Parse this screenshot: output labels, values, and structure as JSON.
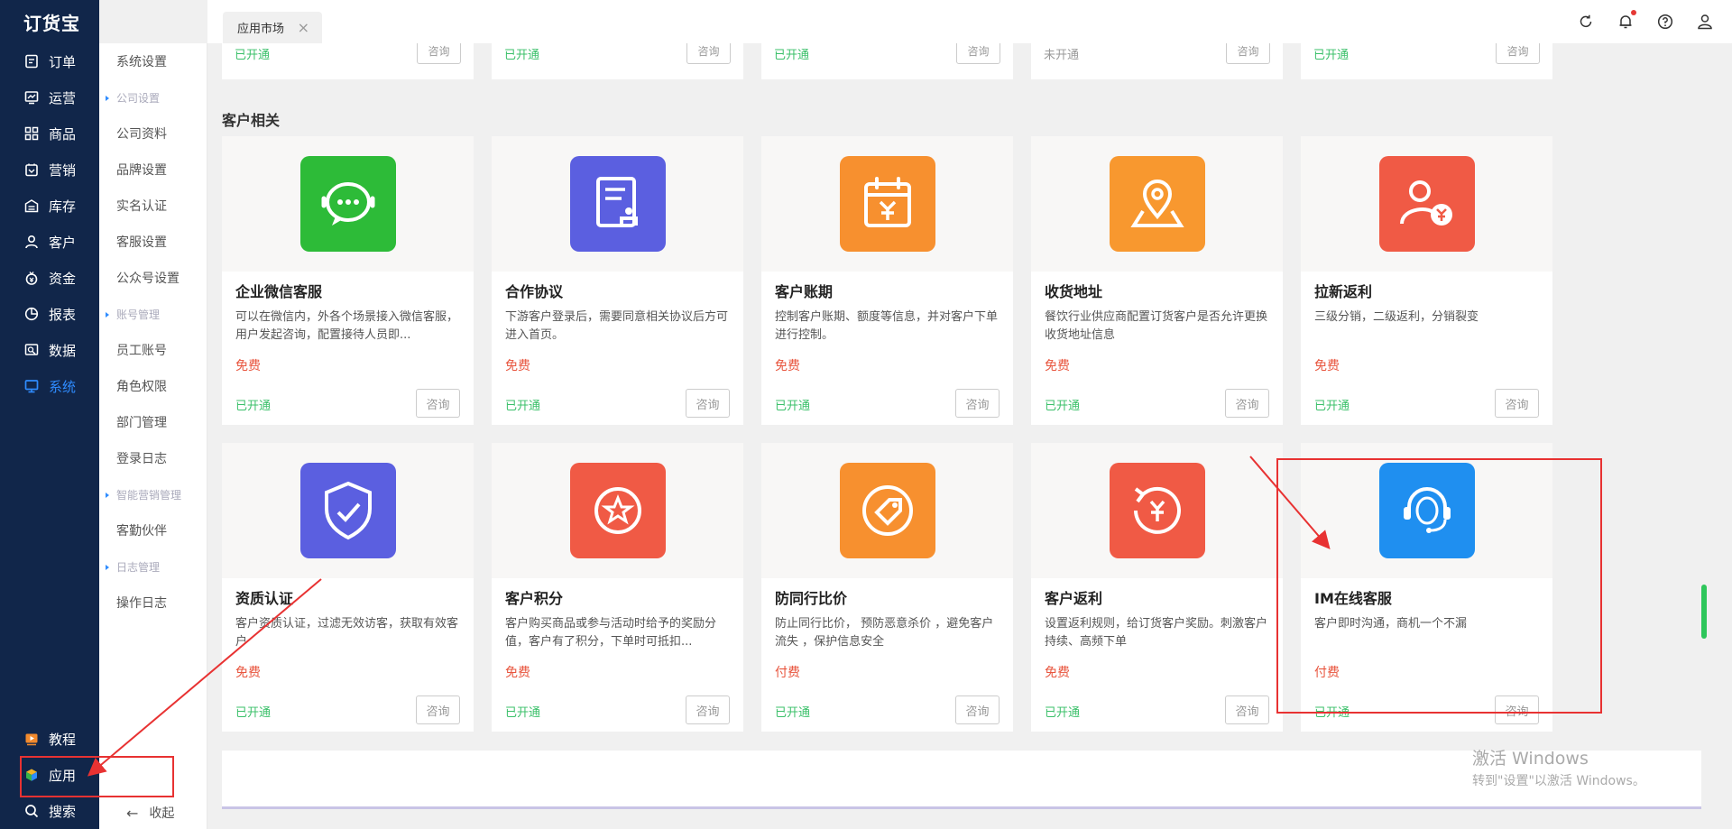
{
  "nav": {
    "logo": "订货宝",
    "items": [
      {
        "label": "订单",
        "icon": "order-icon"
      },
      {
        "label": "运营",
        "icon": "operation-icon"
      },
      {
        "label": "商品",
        "icon": "goods-icon"
      },
      {
        "label": "营销",
        "icon": "marketing-icon"
      },
      {
        "label": "库存",
        "icon": "warehouse-icon"
      },
      {
        "label": "客户",
        "icon": "customer-icon"
      },
      {
        "label": "资金",
        "icon": "money-icon"
      },
      {
        "label": "报表",
        "icon": "report-icon"
      },
      {
        "label": "数据",
        "icon": "data-icon"
      },
      {
        "label": "系统",
        "icon": "system-icon"
      }
    ],
    "bottom": [
      {
        "label": "教程",
        "icon": "tutorial-icon"
      },
      {
        "label": "应用",
        "icon": "app-icon"
      },
      {
        "label": "搜索",
        "icon": "search-icon"
      }
    ]
  },
  "submenu": {
    "items": [
      "系统设置",
      "公司设置",
      "公司资料",
      "品牌设置",
      "实名认证",
      "客服设置",
      "公众号设置",
      "账号管理",
      "员工账号",
      "角色权限",
      "部门管理",
      "登录日志",
      "智能营销管理",
      "客勤伙伴",
      "日志管理",
      "操作日志"
    ],
    "collapse": "收起"
  },
  "tab": {
    "label": "应用市场",
    "close": "×"
  },
  "top_partial": [
    {
      "status": "已开通",
      "button": "咨询"
    },
    {
      "status": "已开通",
      "button": "咨询"
    },
    {
      "status": "已开通",
      "button": "咨询"
    },
    {
      "status": "未开通",
      "button": "咨询"
    },
    {
      "status": "已开通",
      "button": "咨询"
    }
  ],
  "section": {
    "title": "客户相关"
  },
  "row1": [
    {
      "name": "企业微信客服",
      "desc": "可以在微信内，外各个场景接入微信客服，用户发起咨询，配置接待人员即...",
      "price": "免费",
      "status": "已开通",
      "button": "咨询",
      "color": "#2dbb38"
    },
    {
      "name": "合作协议",
      "desc": "下游客户登录后，需要同意相关协议后方可进入首页。",
      "price": "免费",
      "status": "已开通",
      "button": "咨询",
      "color": "#5b5fe0"
    },
    {
      "name": "客户账期",
      "desc": "控制客户账期、额度等信息，并对客户下单进行控制。",
      "price": "免费",
      "status": "已开通",
      "button": "咨询",
      "color": "#f7902f"
    },
    {
      "name": "收货地址",
      "desc": "餐饮行业供应商配置订货客户是否允许更换收货地址信息",
      "price": "免费",
      "status": "已开通",
      "button": "咨询",
      "color": "#f8982f"
    },
    {
      "name": "拉新返利",
      "desc": "三级分销，二级返利，分销裂变",
      "price": "免费",
      "status": "已开通",
      "button": "咨询",
      "color": "#f05a45"
    }
  ],
  "row2": [
    {
      "name": "资质认证",
      "desc": "客户资质认证，过滤无效访客，获取有效客户",
      "price": "免费",
      "status": "已开通",
      "button": "咨询",
      "color": "#5b5fe0"
    },
    {
      "name": "客户积分",
      "desc": "客户购买商品或参与活动时给予的奖励分值，客户有了积分，下单时可抵扣...",
      "price": "免费",
      "status": "已开通",
      "button": "咨询",
      "color": "#f05a45"
    },
    {
      "name": "防同行比价",
      "desc": "防止同行比价， 预防恶意杀价 ，避免客户流失 ，保护信息安全",
      "price": "付费",
      "status": "已开通",
      "button": "咨询",
      "color": "#f7902f"
    },
    {
      "name": "客户返利",
      "desc": "设置返利规则，给订货客户奖励。刺激客户持续、高频下单",
      "price": "免费",
      "status": "已开通",
      "button": "咨询",
      "color": "#f05a45"
    },
    {
      "name": "IM在线客服",
      "desc": "客户即时沟通，商机一个不漏",
      "price": "付费",
      "status": "已开通",
      "button": "咨询",
      "color": "#1f8ff0"
    }
  ],
  "watermark": {
    "line1": "激活 Windows",
    "line2": "转到\"设置\"以激活 Windows。"
  }
}
